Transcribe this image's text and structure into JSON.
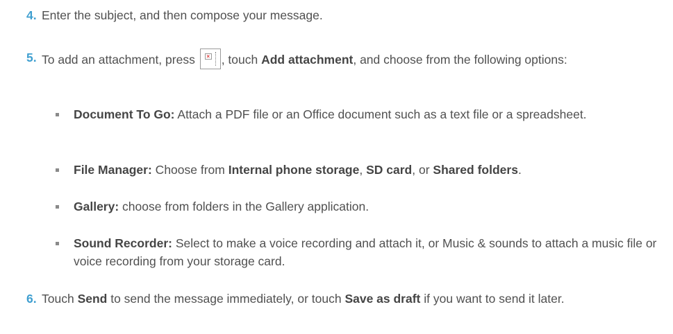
{
  "steps": [
    {
      "number": "4.",
      "text": "Enter the subject, and then compose your message."
    },
    {
      "number": "5.",
      "part1": "To add an attachment, press ",
      "icon": "menu-key-icon",
      "part2": ", touch ",
      "bold1": "Add attachment",
      "part3": ", and choose from the following options:"
    },
    {
      "number": "6.",
      "part1": "Touch ",
      "bold1": "Send",
      "part2": " to send the message immediately, or touch ",
      "bold2": "Save as draft",
      "part3": " if you want to send it later."
    }
  ],
  "options": [
    {
      "title": "Document To Go:",
      "text": " Attach a PDF file or an Office document such as a text file or a spreadsheet."
    },
    {
      "title": "File Manager:",
      "text1": " Choose from ",
      "bold1": "Internal phone storage",
      "text2": ", ",
      "bold2": "SD card",
      "text3": ", or ",
      "bold3": "Shared folders",
      "text4": "."
    },
    {
      "title": "Gallery:",
      "text": " choose from folders in the Gallery application."
    },
    {
      "title": "Sound Recorder:",
      "text": " Select to make a voice recording and attach it, or Music & sounds to attach a music file or voice recording from your storage card."
    }
  ],
  "colors": {
    "step_number": "#3f9fd0",
    "body_text": "#505050",
    "bullet": "#8a8a8a"
  }
}
